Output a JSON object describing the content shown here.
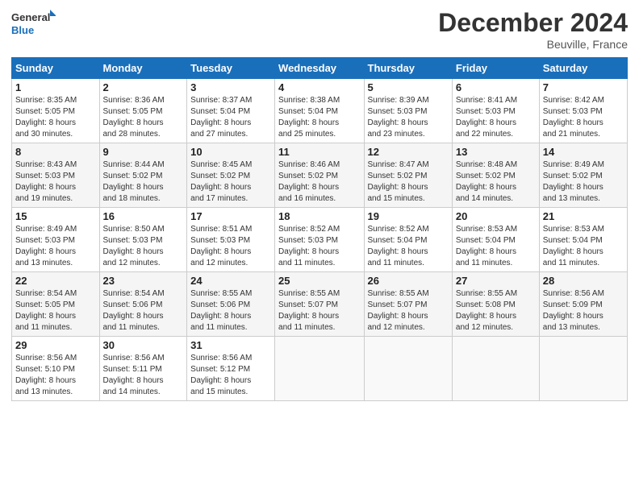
{
  "logo": {
    "line1": "General",
    "line2": "Blue"
  },
  "title": "December 2024",
  "location": "Beuville, France",
  "weekdays": [
    "Sunday",
    "Monday",
    "Tuesday",
    "Wednesday",
    "Thursday",
    "Friday",
    "Saturday"
  ],
  "weeks": [
    [
      {
        "day": "1",
        "info": "Sunrise: 8:35 AM\nSunset: 5:05 PM\nDaylight: 8 hours\nand 30 minutes."
      },
      {
        "day": "2",
        "info": "Sunrise: 8:36 AM\nSunset: 5:05 PM\nDaylight: 8 hours\nand 28 minutes."
      },
      {
        "day": "3",
        "info": "Sunrise: 8:37 AM\nSunset: 5:04 PM\nDaylight: 8 hours\nand 27 minutes."
      },
      {
        "day": "4",
        "info": "Sunrise: 8:38 AM\nSunset: 5:04 PM\nDaylight: 8 hours\nand 25 minutes."
      },
      {
        "day": "5",
        "info": "Sunrise: 8:39 AM\nSunset: 5:03 PM\nDaylight: 8 hours\nand 23 minutes."
      },
      {
        "day": "6",
        "info": "Sunrise: 8:41 AM\nSunset: 5:03 PM\nDaylight: 8 hours\nand 22 minutes."
      },
      {
        "day": "7",
        "info": "Sunrise: 8:42 AM\nSunset: 5:03 PM\nDaylight: 8 hours\nand 21 minutes."
      }
    ],
    [
      {
        "day": "8",
        "info": "Sunrise: 8:43 AM\nSunset: 5:03 PM\nDaylight: 8 hours\nand 19 minutes."
      },
      {
        "day": "9",
        "info": "Sunrise: 8:44 AM\nSunset: 5:02 PM\nDaylight: 8 hours\nand 18 minutes."
      },
      {
        "day": "10",
        "info": "Sunrise: 8:45 AM\nSunset: 5:02 PM\nDaylight: 8 hours\nand 17 minutes."
      },
      {
        "day": "11",
        "info": "Sunrise: 8:46 AM\nSunset: 5:02 PM\nDaylight: 8 hours\nand 16 minutes."
      },
      {
        "day": "12",
        "info": "Sunrise: 8:47 AM\nSunset: 5:02 PM\nDaylight: 8 hours\nand 15 minutes."
      },
      {
        "day": "13",
        "info": "Sunrise: 8:48 AM\nSunset: 5:02 PM\nDaylight: 8 hours\nand 14 minutes."
      },
      {
        "day": "14",
        "info": "Sunrise: 8:49 AM\nSunset: 5:02 PM\nDaylight: 8 hours\nand 13 minutes."
      }
    ],
    [
      {
        "day": "15",
        "info": "Sunrise: 8:49 AM\nSunset: 5:03 PM\nDaylight: 8 hours\nand 13 minutes."
      },
      {
        "day": "16",
        "info": "Sunrise: 8:50 AM\nSunset: 5:03 PM\nDaylight: 8 hours\nand 12 minutes."
      },
      {
        "day": "17",
        "info": "Sunrise: 8:51 AM\nSunset: 5:03 PM\nDaylight: 8 hours\nand 12 minutes."
      },
      {
        "day": "18",
        "info": "Sunrise: 8:52 AM\nSunset: 5:03 PM\nDaylight: 8 hours\nand 11 minutes."
      },
      {
        "day": "19",
        "info": "Sunrise: 8:52 AM\nSunset: 5:04 PM\nDaylight: 8 hours\nand 11 minutes."
      },
      {
        "day": "20",
        "info": "Sunrise: 8:53 AM\nSunset: 5:04 PM\nDaylight: 8 hours\nand 11 minutes."
      },
      {
        "day": "21",
        "info": "Sunrise: 8:53 AM\nSunset: 5:04 PM\nDaylight: 8 hours\nand 11 minutes."
      }
    ],
    [
      {
        "day": "22",
        "info": "Sunrise: 8:54 AM\nSunset: 5:05 PM\nDaylight: 8 hours\nand 11 minutes."
      },
      {
        "day": "23",
        "info": "Sunrise: 8:54 AM\nSunset: 5:06 PM\nDaylight: 8 hours\nand 11 minutes."
      },
      {
        "day": "24",
        "info": "Sunrise: 8:55 AM\nSunset: 5:06 PM\nDaylight: 8 hours\nand 11 minutes."
      },
      {
        "day": "25",
        "info": "Sunrise: 8:55 AM\nSunset: 5:07 PM\nDaylight: 8 hours\nand 11 minutes."
      },
      {
        "day": "26",
        "info": "Sunrise: 8:55 AM\nSunset: 5:07 PM\nDaylight: 8 hours\nand 12 minutes."
      },
      {
        "day": "27",
        "info": "Sunrise: 8:55 AM\nSunset: 5:08 PM\nDaylight: 8 hours\nand 12 minutes."
      },
      {
        "day": "28",
        "info": "Sunrise: 8:56 AM\nSunset: 5:09 PM\nDaylight: 8 hours\nand 13 minutes."
      }
    ],
    [
      {
        "day": "29",
        "info": "Sunrise: 8:56 AM\nSunset: 5:10 PM\nDaylight: 8 hours\nand 13 minutes."
      },
      {
        "day": "30",
        "info": "Sunrise: 8:56 AM\nSunset: 5:11 PM\nDaylight: 8 hours\nand 14 minutes."
      },
      {
        "day": "31",
        "info": "Sunrise: 8:56 AM\nSunset: 5:12 PM\nDaylight: 8 hours\nand 15 minutes."
      },
      null,
      null,
      null,
      null
    ]
  ]
}
